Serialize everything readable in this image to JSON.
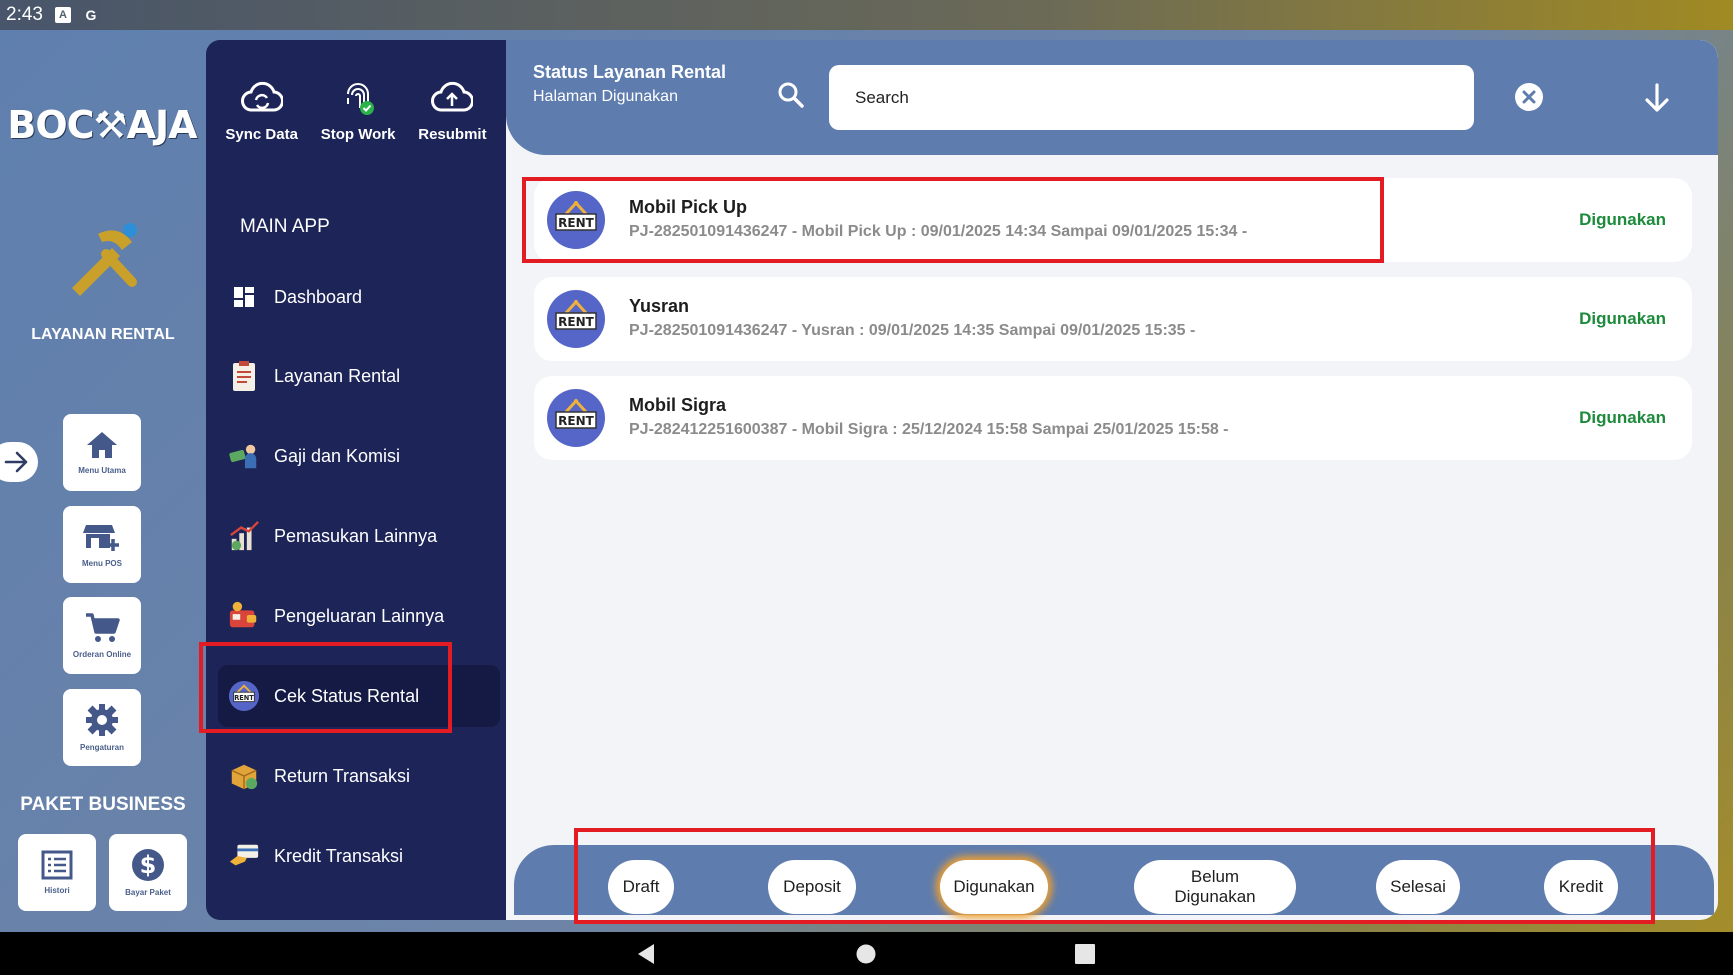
{
  "statusbar": {
    "time": "2:43"
  },
  "rail": {
    "logo_text": "BOC⚒AJA",
    "title": "LAYANAN RENTAL",
    "buttons": [
      {
        "label": "Menu Utama"
      },
      {
        "label": "Menu POS"
      },
      {
        "label": "Orderan Online"
      },
      {
        "label": "Pengaturan"
      }
    ],
    "paket_title": "PAKET BUSINESS",
    "paket_buttons": [
      {
        "label": "Histori"
      },
      {
        "label": "Bayar Paket"
      }
    ]
  },
  "menu": {
    "top_actions": [
      {
        "label": "Sync Data"
      },
      {
        "label": "Stop Work"
      },
      {
        "label": "Resubmit"
      }
    ],
    "section": "MAIN APP",
    "items": [
      {
        "label": "Dashboard"
      },
      {
        "label": "Layanan Rental"
      },
      {
        "label": "Gaji dan Komisi"
      },
      {
        "label": "Pemasukan Lainnya"
      },
      {
        "label": "Pengeluaran Lainnya"
      },
      {
        "label": "Cek Status Rental"
      },
      {
        "label": "Return Transaksi"
      },
      {
        "label": "Kredit Transaksi"
      }
    ]
  },
  "header": {
    "title": "Status Layanan Rental",
    "subtitle": "Halaman Digunakan",
    "search_placeholder": "Search"
  },
  "list": [
    {
      "name": "Mobil Pick Up",
      "detail": "PJ-282501091436247 - Mobil Pick Up : 09/01/2025 14:34 Sampai 09/01/2025 15:34 -",
      "status": "Digunakan"
    },
    {
      "name": "Yusran",
      "detail": "PJ-282501091436247 - Yusran : 09/01/2025 14:35 Sampai 09/01/2025 15:35 -",
      "status": "Digunakan"
    },
    {
      "name": "Mobil Sigra",
      "detail": "PJ-282412251600387 - Mobil Sigra : 25/12/2024 15:58 Sampai 25/01/2025 15:58 -",
      "status": "Digunakan"
    }
  ],
  "avatar_text": "RENT",
  "filters": [
    {
      "label": "Draft"
    },
    {
      "label": "Deposit"
    },
    {
      "label": "Digunakan"
    },
    {
      "label": "Belum Digunakan"
    },
    {
      "label": "Selesai"
    },
    {
      "label": "Kredit"
    }
  ],
  "colors": {
    "accent": "#5e7cad",
    "menu_bg": "#1d2457",
    "status_green": "#1d8a3c",
    "highlight_red": "#e31b23"
  }
}
